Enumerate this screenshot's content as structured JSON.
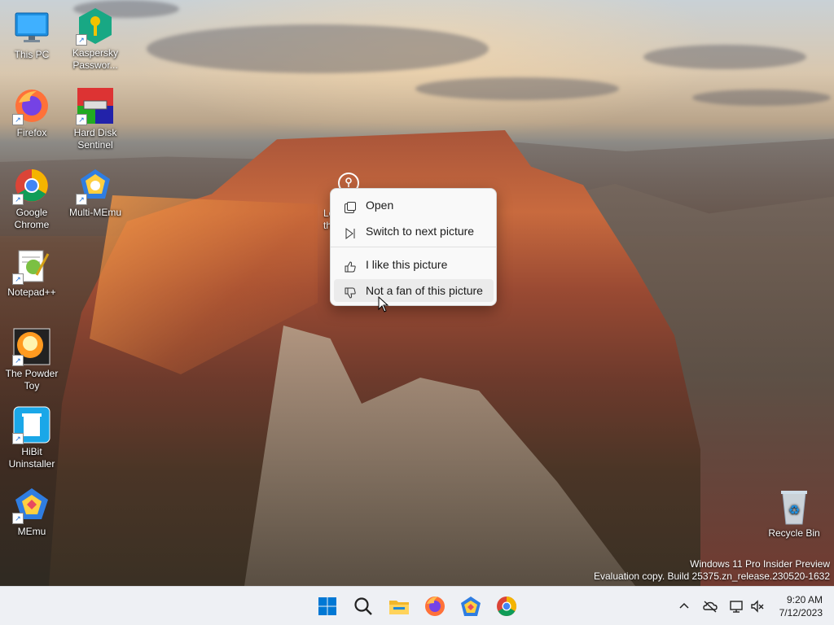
{
  "desktop": {
    "icons": [
      {
        "label": "This PC",
        "icon": "this-pc-icon"
      },
      {
        "label": "Kaspersky Passwor...",
        "icon": "kaspersky-password-icon"
      },
      {
        "label": "Firefox",
        "icon": "firefox-icon"
      },
      {
        "label": "Hard Disk Sentinel",
        "icon": "hard-disk-sentinel-icon"
      },
      {
        "label": "Google Chrome",
        "icon": "chrome-icon"
      },
      {
        "label": "Multi-MEmu",
        "icon": "multi-memu-icon"
      },
      {
        "label": "Notepad++",
        "icon": "notepadpp-icon"
      },
      {
        "label": "The Powder Toy",
        "icon": "powder-toy-icon"
      },
      {
        "label": "HiBit Uninstaller",
        "icon": "hibit-uninstaller-icon"
      },
      {
        "label": "MEmu",
        "icon": "memu-icon"
      },
      {
        "label": "Recycle Bin",
        "icon": "recycle-bin-icon"
      }
    ],
    "partial_label": "Le\nth"
  },
  "context_menu": {
    "items": [
      {
        "label": "Open",
        "icon": "open-icon"
      },
      {
        "label": "Switch to next picture",
        "icon": "next-picture-icon"
      },
      {
        "label": "I like this picture",
        "icon": "thumbs-up-icon"
      },
      {
        "label": "Not a fan of this picture",
        "icon": "thumbs-down-icon"
      }
    ]
  },
  "watermark": {
    "line1": "Windows 11 Pro Insider Preview",
    "line2": "Evaluation copy. Build 25375.zn_release.230520-1632"
  },
  "taskbar": {
    "apps": [
      "start-icon",
      "search-icon",
      "file-explorer-icon",
      "firefox-icon",
      "memu-icon",
      "chrome-icon"
    ],
    "tray": [
      "chevron-up-icon",
      "onedrive-icon",
      "network-icon",
      "volume-muted-icon"
    ],
    "time": "9:20 AM",
    "date": "7/12/2023"
  },
  "colors": {
    "accent": "#0067c0",
    "taskbar_bg": "#eef0f4",
    "menu_bg": "#f9f9f9"
  }
}
